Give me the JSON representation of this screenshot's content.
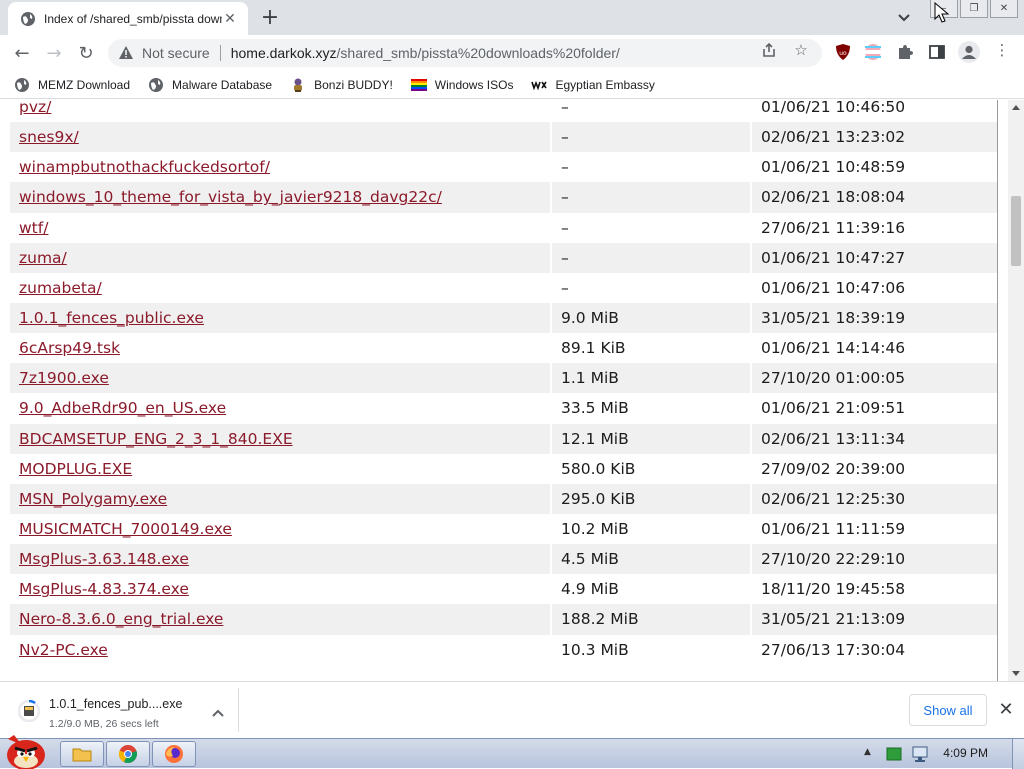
{
  "tab": {
    "title": "Index of /shared_smb/pissta downloads folder/",
    "close_glyph": "✕",
    "new_tab_glyph": "+",
    "tab_search_glyph": "⌄"
  },
  "window_controls": {
    "minimize": "–",
    "maximize": "❐",
    "close": "✕"
  },
  "toolbar": {
    "back_glyph": "←",
    "forward_glyph": "→",
    "reload_glyph": "↻",
    "security_label": "Not secure",
    "url_host": "home.darkok.xyz",
    "url_path": "/shared_smb/pissta%20downloads%20folder/",
    "share_glyph": "⇪",
    "star_glyph": "☆",
    "menu_glyph": "⋮"
  },
  "bookmarks": [
    {
      "label": "MEMZ Download",
      "icon": "globe-icon"
    },
    {
      "label": "Malware Database",
      "icon": "globe-icon"
    },
    {
      "label": "Bonzi BUDDY!",
      "icon": "bonzi-icon"
    },
    {
      "label": "Windows ISOs",
      "icon": "rainbow-flag-icon"
    },
    {
      "label": "Egyptian Embassy",
      "icon": "wix-icon"
    }
  ],
  "listing": {
    "rows": [
      {
        "name": "pvz/",
        "size": "–",
        "date": "01/06/21 10:46:50"
      },
      {
        "name": "snes9x/",
        "size": "–",
        "date": "02/06/21 13:23:02"
      },
      {
        "name": "winampbutnothackfuckedsortof/",
        "size": "–",
        "date": "01/06/21 10:48:59"
      },
      {
        "name": "windows_10_theme_for_vista_by_javier9218_davg22c/",
        "size": "–",
        "date": "02/06/21 18:08:04"
      },
      {
        "name": "wtf/",
        "size": "–",
        "date": "27/06/21 11:39:16"
      },
      {
        "name": "zuma/",
        "size": "–",
        "date": "01/06/21 10:47:27"
      },
      {
        "name": "zumabeta/",
        "size": "–",
        "date": "01/06/21 10:47:06"
      },
      {
        "name": "1.0.1_fences_public.exe",
        "size": "9.0 MiB",
        "date": "31/05/21 18:39:19"
      },
      {
        "name": "6cArsp49.tsk",
        "size": "89.1 KiB",
        "date": "01/06/21 14:14:46"
      },
      {
        "name": "7z1900.exe",
        "size": "1.1 MiB",
        "date": "27/10/20 01:00:05"
      },
      {
        "name": "9.0_AdbeRdr90_en_US.exe",
        "size": "33.5 MiB",
        "date": "01/06/21 21:09:51"
      },
      {
        "name": "BDCAMSETUP_ENG_2_3_1_840.EXE",
        "size": "12.1 MiB",
        "date": "02/06/21 13:11:34"
      },
      {
        "name": "MODPLUG.EXE",
        "size": "580.0 KiB",
        "date": "27/09/02 20:39:00"
      },
      {
        "name": "MSN_Polygamy.exe",
        "size": "295.0 KiB",
        "date": "02/06/21 12:25:30"
      },
      {
        "name": "MUSICMATCH_7000149.exe",
        "size": "10.2 MiB",
        "date": "01/06/21 11:11:59"
      },
      {
        "name": "MsgPlus-3.63.148.exe",
        "size": "4.5 MiB",
        "date": "27/10/20 22:29:10"
      },
      {
        "name": "MsgPlus-4.83.374.exe",
        "size": "4.9 MiB",
        "date": "18/11/20 19:45:58"
      },
      {
        "name": "Nero-8.3.6.0_eng_trial.exe",
        "size": "188.2 MiB",
        "date": "31/05/21 21:13:09"
      },
      {
        "name": "Nv2-PC.exe",
        "size": "10.3 MiB",
        "date": "27/06/13 17:30:04"
      }
    ]
  },
  "download": {
    "file_name": "1.0.1_fences_pub....exe",
    "status": "1.2/9.0 MB, 26 secs left",
    "chevron_glyph": "⌃",
    "show_all_label": "Show all",
    "close_glyph": "✕"
  },
  "taskbar": {
    "clock": "4:09 PM",
    "tray_arrow_glyph": "▲"
  },
  "colors": {
    "link": "#8b1a2b",
    "alt_row": "#f0f0f0",
    "accent": "#1a73e8"
  }
}
